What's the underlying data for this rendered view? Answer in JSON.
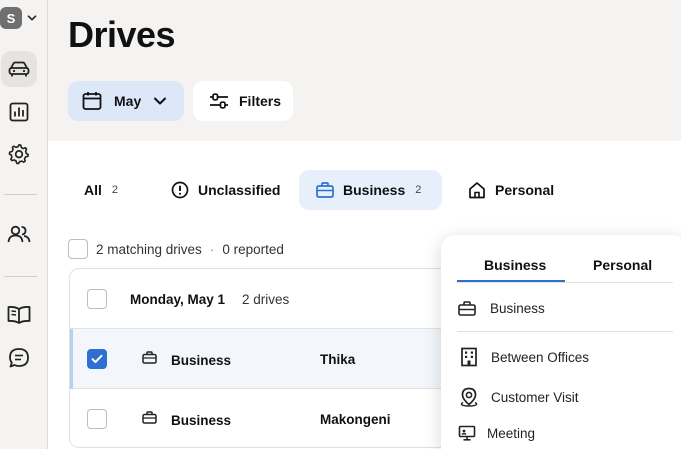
{
  "account": {
    "initial": "S"
  },
  "header": {
    "title": "Drives",
    "month_label": "May",
    "filters_label": "Filters"
  },
  "tabs": [
    {
      "label": "All",
      "count": "2"
    },
    {
      "label": "Unclassified",
      "count": ""
    },
    {
      "label": "Business",
      "count": "2"
    },
    {
      "label": "Personal",
      "count": ""
    }
  ],
  "summary": {
    "matching": "2 matching drives",
    "separator": "·",
    "reported": "0 reported"
  },
  "group": {
    "title": "Monday, May 1",
    "count": "2 drives"
  },
  "drives": [
    {
      "purpose": "Business",
      "place": "Thika",
      "checked": true
    },
    {
      "purpose": "Business",
      "place": "Makongeni",
      "checked": false
    }
  ],
  "popover": {
    "tabs": [
      "Business",
      "Personal"
    ],
    "items": [
      "Business",
      "Between Offices",
      "Customer Visit",
      "Meeting"
    ]
  },
  "colors": {
    "accent": "#2f6fd1",
    "selected_bg": "#dce8f7"
  }
}
